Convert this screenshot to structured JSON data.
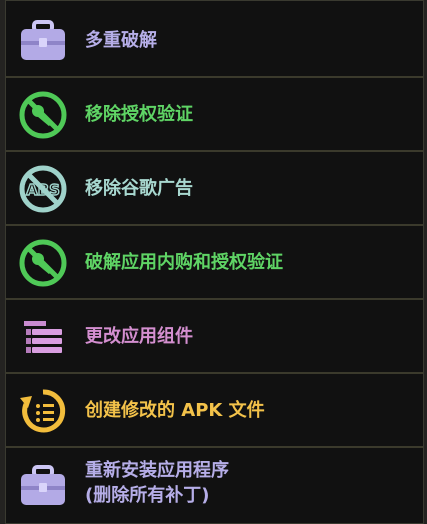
{
  "menu": {
    "items": [
      {
        "id": "multi-crack",
        "label": "多重破解",
        "color": "#b6aee8",
        "icon": "briefcase-icon"
      },
      {
        "id": "remove-license",
        "label": "移除授权验证",
        "color": "#5fd465",
        "icon": "no-key-icon"
      },
      {
        "id": "remove-ads",
        "label": "移除谷歌广告",
        "color": "#a8d8d0",
        "icon": "no-ads-icon"
      },
      {
        "id": "crack-iap",
        "label": "破解应用内购和授权验证",
        "color": "#5fd465",
        "icon": "no-key-icon"
      },
      {
        "id": "change-components",
        "label": "更改应用组件",
        "color": "#d48fd0",
        "icon": "component-list-icon"
      },
      {
        "id": "create-apk",
        "label": "创建修改的 APK 文件",
        "color": "#f3c24a",
        "icon": "rebuild-apk-icon"
      },
      {
        "id": "reinstall",
        "label": "重新安装应用程序\n(删除所有补丁)",
        "label_line1": "重新安装应用程序",
        "label_line2": "(删除所有补丁)",
        "color": "#b6aee8",
        "icon": "briefcase-icon"
      }
    ]
  }
}
